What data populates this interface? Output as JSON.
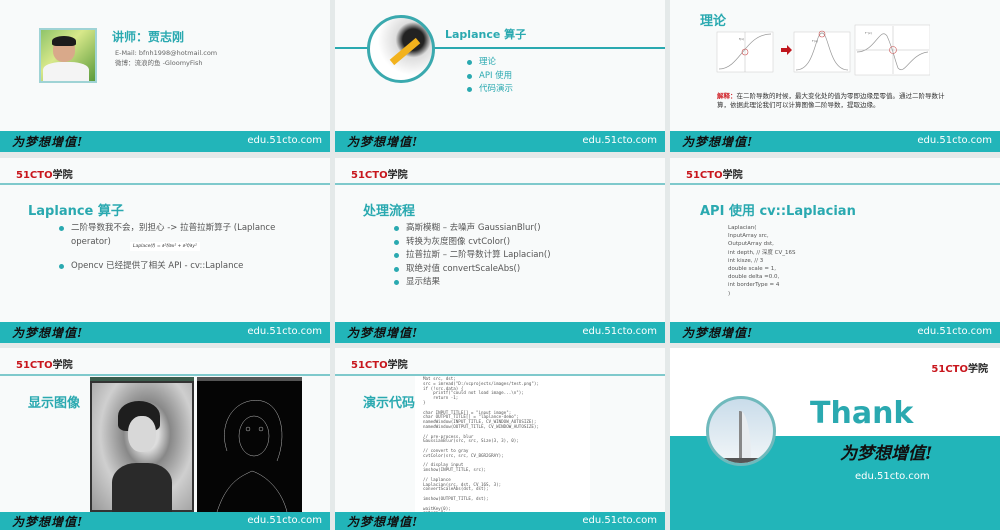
{
  "common": {
    "slogan": "为梦想增值!",
    "url": "edu.51cto.com",
    "logo_red": "51CTO",
    "logo_black": "学院"
  },
  "slide1": {
    "title": "讲师：贾志刚",
    "email": "E-Mail: bfnh1998@hotmail.com",
    "weibo": "微博：流浪的鱼 -GloomyFish"
  },
  "slide2": {
    "title": "Laplance 算子",
    "items": [
      "理论",
      "API 使用",
      "代码演示"
    ]
  },
  "slide3": {
    "title": "理论",
    "note_label": "解释：",
    "note": "在二阶导数的时候，最大变化处的值为零即边缘是零值。通过二阶导数计算，依据此理论我们可以计算图像二阶导数，提取边缘。",
    "graph_labels": [
      "f(x)",
      "f'(x)",
      "f''(x)"
    ]
  },
  "slide4": {
    "title": "Laplance 算子",
    "items": [
      "二阶导数我不会，别担心 -> 拉普拉斯算子 (Laplance operator)",
      "Opencv 已经提供了相关 API - cv::Laplance"
    ],
    "formula": "Laplace(f) = ∂²f/∂x² + ∂²f/∂y²"
  },
  "slide5": {
    "title": "处理流程",
    "items": [
      "高斯模糊 – 去噪声 GaussianBlur()",
      "转换为灰度图像 cvtColor()",
      "拉普拉斯 – 二阶导数计算 Laplacian()",
      "取绝对值 convertScaleAbs()",
      "显示结果"
    ]
  },
  "slide6": {
    "title": "API 使用 cv::Laplacian",
    "code": [
      "Laplacian(",
      "InputArray src,",
      "OutputArray dst,",
      "int depth, // 深度 CV_16S",
      "int kisze, // 3",
      "double scale = 1,",
      "double delta =0.0,",
      "int borderType = 4",
      ")"
    ]
  },
  "slide7": {
    "title": "显示图像"
  },
  "slide8": {
    "title": "演示代码",
    "code": "Mat src, dst;\nsrc = imread(\"D:/vcprojects/images/test.png\");\nif (!src.data) {\n    printf(\"could not load image...\\n\");\n    return -1;\n}\n\nchar INPUT_TITLE[] = \"input image\";\nchar OUTPUT_TITLE[] = \"laplance-demo\";\nnamedWindow(INPUT_TITLE, CV_WINDOW_AUTOSIZE);\nnamedWindow(OUTPUT_TITLE, CV_WINDOW_AUTOSIZE);\n\n// pre-process, blur\nGaussianBlur(src, src, Size(3, 3), 0);\n\n// convert to gray\ncvtColor(src, src, CV_BGR2GRAY);\n\n// display input\nimshow(INPUT_TITLE, src);\n\n// laplance\nLaplacian(src, dst, CV_16S, 3);\nconvertScaleAbs(dst, dst);\n\nimshow(OUTPUT_TITLE, dst);\n\nwaitKey(0);\nreturn 0;"
  },
  "slide9": {
    "title": "Thank"
  }
}
